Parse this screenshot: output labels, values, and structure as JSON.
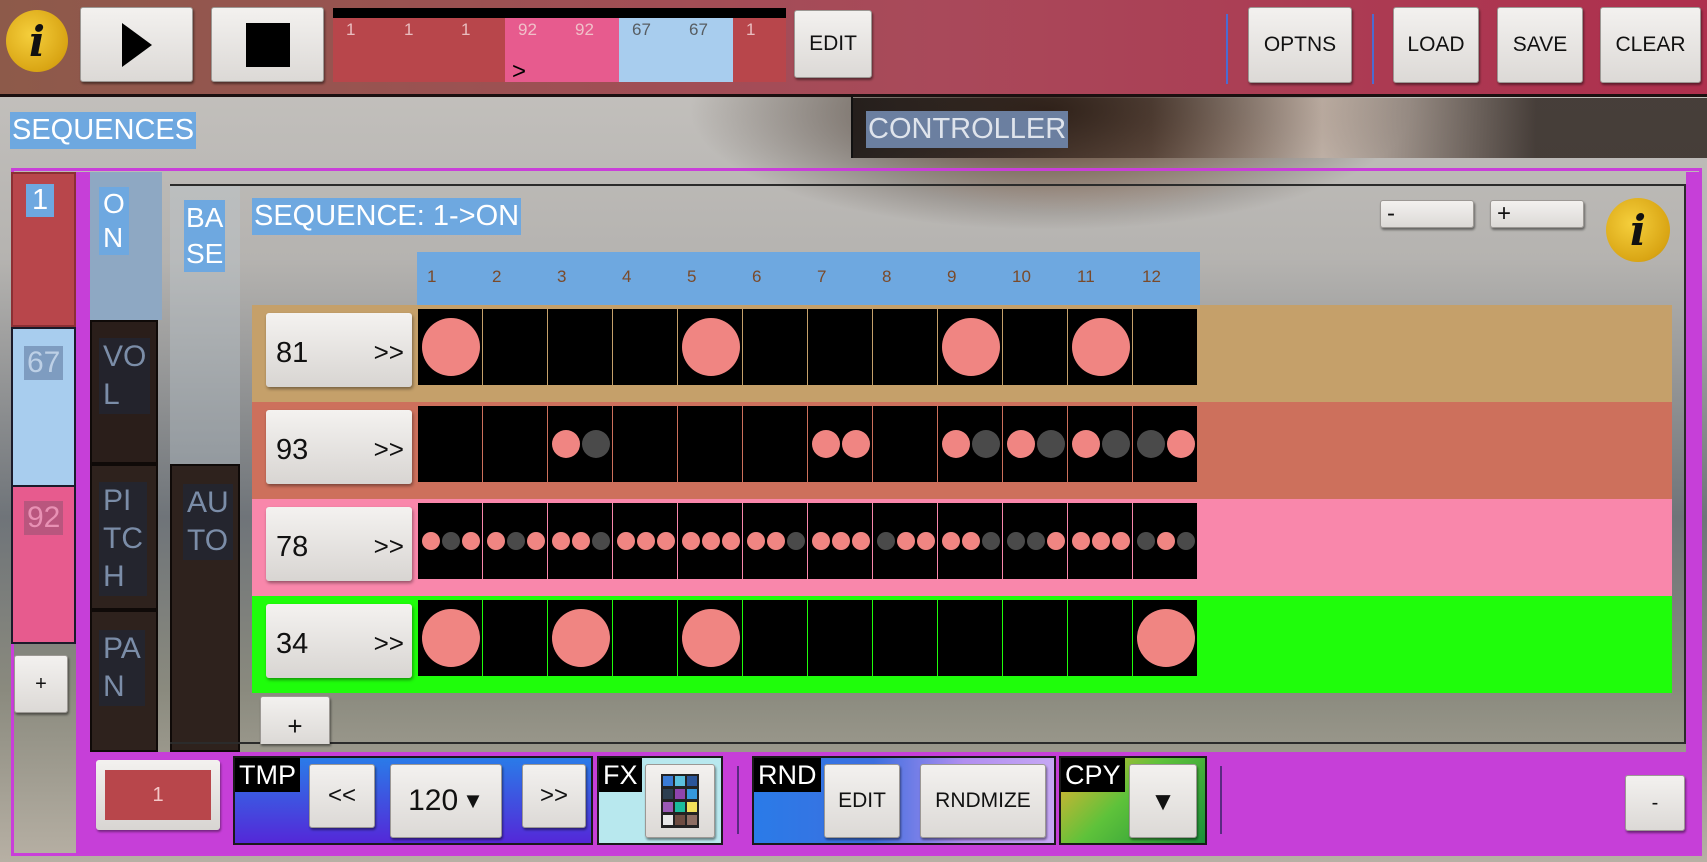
{
  "topbar": {
    "info_glyph": "i",
    "timeline": [
      {
        "value": "1",
        "color": "#b8464b"
      },
      {
        "value": "1",
        "color": "#b8464b"
      },
      {
        "value": "1",
        "color": "#b8464b"
      },
      {
        "value": "92",
        "color": "#e75b8e"
      },
      {
        "value": "92",
        "color": "#e75b8e"
      },
      {
        "value": "67",
        "color": "#a8cdee"
      },
      {
        "value": "67",
        "color": "#a8cdee"
      },
      {
        "value": "1",
        "color": "#b8464b"
      }
    ],
    "cursor_glyph": ">",
    "edit_label": "EDIT",
    "optns_label": "OPTNS",
    "load_label": "LOAD",
    "save_label": "SAVE",
    "clear_label": "CLEAR"
  },
  "panels": {
    "sequences_label": "SEQUENCES",
    "controller_label": "CONTROLLER"
  },
  "left_column": {
    "items": [
      "1",
      "67",
      "92"
    ],
    "add_label": "+"
  },
  "param_column": {
    "on_label": "O\nN",
    "vol_label": "VO\nL",
    "pitch_label": "PI\nTC\nH",
    "pan_label": "PA\nN"
  },
  "sub_column": {
    "base_label": "BA\nSE",
    "auto_label": "AU\nTO"
  },
  "editor": {
    "title": "SEQUENCE: 1->ON",
    "zoom_minus": "-",
    "zoom_plus": "+",
    "info_glyph": "i",
    "steps": [
      "1",
      "2",
      "3",
      "4",
      "5",
      "6",
      "7",
      "8",
      "9",
      "10",
      "11",
      "12"
    ],
    "add_row_label": "+",
    "rows": [
      {
        "label": "81",
        "arrows": ">>",
        "bg": "#c5a06a",
        "grid": "#c5a06a",
        "cells": [
          [
            1
          ],
          [],
          [],
          [],
          [
            1
          ],
          [],
          [],
          [],
          [
            1
          ],
          [],
          [
            1
          ],
          []
        ]
      },
      {
        "label": "93",
        "arrows": ">>",
        "bg": "#cd705c",
        "grid": "#cd705c",
        "cells": [
          [],
          [],
          [
            1,
            0
          ],
          [],
          [],
          [],
          [
            1,
            1
          ],
          [],
          [
            1,
            0
          ],
          [
            1,
            0
          ],
          [
            1,
            0
          ],
          [
            0,
            1
          ]
        ]
      },
      {
        "label": "78",
        "arrows": ">>",
        "bg": "#f987ab",
        "grid": "#f987ab",
        "cells": [
          [
            1,
            0,
            1
          ],
          [
            1,
            0,
            1
          ],
          [
            1,
            1,
            0
          ],
          [
            1,
            1,
            1
          ],
          [
            1,
            1,
            1
          ],
          [
            1,
            1,
            0
          ],
          [
            1,
            1,
            1
          ],
          [
            0,
            1,
            1
          ],
          [
            1,
            1,
            0
          ],
          [
            0,
            0,
            1
          ],
          [
            1,
            1,
            1
          ],
          [
            0,
            1,
            0
          ]
        ]
      },
      {
        "label": "34",
        "arrows": ">>",
        "bg": "#1ffd0b",
        "grid": "#1ffd0b",
        "cells": [
          [
            1
          ],
          [],
          [
            1
          ],
          [],
          [
            1
          ],
          [],
          [],
          [],
          [],
          [],
          [],
          [
            1
          ]
        ]
      }
    ]
  },
  "bottombar": {
    "current": "1",
    "tmp_label": "TMP",
    "tempo_prev": "<<",
    "tempo_value": "120",
    "tempo_caret": "▼",
    "tempo_next": ">>",
    "fx_label": "FX",
    "rnd_label": "RND",
    "rnd_edit": "EDIT",
    "rnd_randomize": "RNDMIZE",
    "cpy_label": "CPY",
    "cpy_caret": "▼",
    "collapse_label": "-"
  },
  "colors": {
    "dot_on": "#f08582",
    "dot_off": "#4a4a4a",
    "accent_blue": "#6ea8e0",
    "frame_magenta": "#c93fd9"
  }
}
